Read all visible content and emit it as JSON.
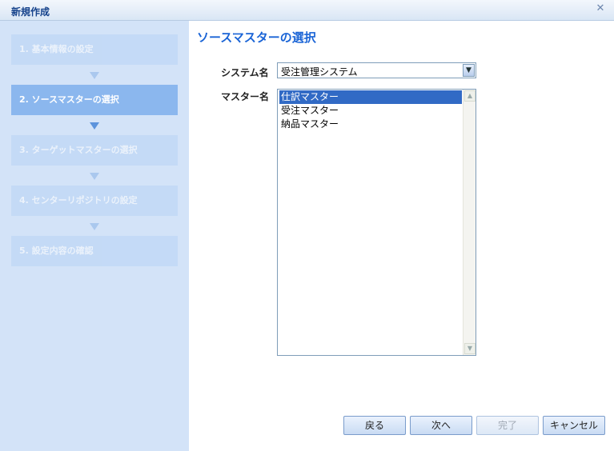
{
  "window": {
    "title": "新規作成",
    "close_icon": "close-icon"
  },
  "steps": [
    {
      "label": "1. 基本情報の設定",
      "state": "inactive"
    },
    {
      "label": "2. ソースマスターの選択",
      "state": "active"
    },
    {
      "label": "3. ターゲットマスターの選択",
      "state": "inactive"
    },
    {
      "label": "4. センターリポジトリの設定",
      "state": "inactive"
    },
    {
      "label": "5. 設定内容の確認",
      "state": "inactive"
    }
  ],
  "main": {
    "heading": "ソースマスターの選択",
    "system_label": "システム名",
    "system_value": "受注管理システム",
    "master_label": "マスター名",
    "masters": [
      "仕訳マスター",
      "受注マスター",
      "納品マスター"
    ],
    "selected_master": "仕訳マスター"
  },
  "buttons": {
    "back": "戻る",
    "next": "次へ",
    "finish": "完了",
    "cancel": "キャンセル"
  },
  "colors": {
    "accent": "#1a64d6",
    "selection": "#316ac5",
    "sidebar": "#d3e3f8"
  }
}
